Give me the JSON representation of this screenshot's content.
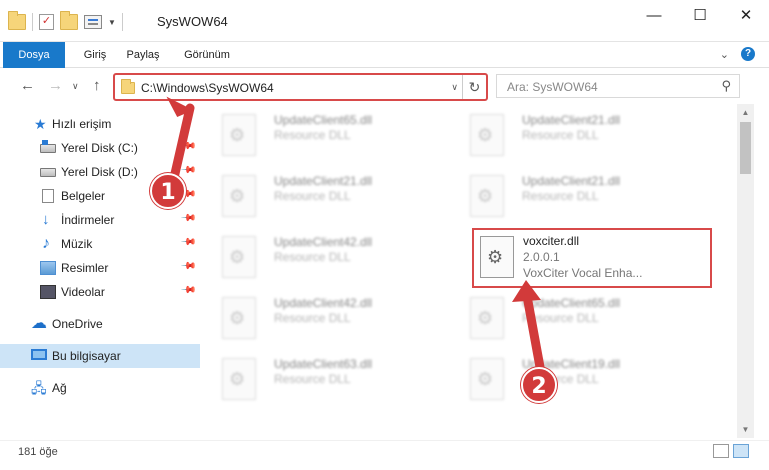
{
  "window": {
    "title": "SysWOW64",
    "controls": [
      "minimize-icon",
      "maximize-icon",
      "close-icon"
    ]
  },
  "ribbon": {
    "tabs": [
      "Dosya",
      "Giriş",
      "Paylaş",
      "Görünüm"
    ]
  },
  "address": {
    "path": "C:\\Windows\\SysWOW64",
    "search_placeholder": "Ara: SysWOW64"
  },
  "sidebar": {
    "quick_access": "Hızlı erişim",
    "items": [
      {
        "label": "Yerel Disk (C:)",
        "icon": "drive-icon"
      },
      {
        "label": "Yerel Disk (D:)",
        "icon": "drive-icon"
      },
      {
        "label": "Belgeler",
        "icon": "documents-icon"
      },
      {
        "label": "İndirmeler",
        "icon": "downloads-icon"
      },
      {
        "label": "Müzik",
        "icon": "music-icon"
      },
      {
        "label": "Resimler",
        "icon": "pictures-icon"
      },
      {
        "label": "Videolar",
        "icon": "videos-icon"
      }
    ],
    "onedrive": "OneDrive",
    "this_pc": "Bu bilgisayar",
    "network": "Ağ"
  },
  "files": [
    {
      "name": "UpdateClient65.dll",
      "type": "Resource DLL"
    },
    {
      "name": "UpdateClient21.dll",
      "type": "Resource DLL"
    },
    {
      "name": "UpdateClient21.dll",
      "type": "Resource DLL"
    },
    {
      "name": "UpdateClient21.dll",
      "type": "Resource DLL"
    },
    {
      "name": "UpdateClient42.dll",
      "type": "Resource DLL"
    },
    {
      "name": "voxciter.dll",
      "version": "2.0.0.1",
      "description": "VoxCiter Vocal Enha..."
    },
    {
      "name": "UpdateClient42.dll",
      "type": "Resource DLL"
    },
    {
      "name": "UpdateClient65.dll",
      "type": "Resource DLL"
    },
    {
      "name": "UpdateClient63.dll",
      "type": "Resource DLL"
    },
    {
      "name": "UpdateClient19.dll",
      "type": "Resource DLL"
    }
  ],
  "status": {
    "item_count": "181 öğe"
  },
  "annotations": {
    "step1": "1",
    "step2": "2",
    "color": "#d23a3a"
  }
}
